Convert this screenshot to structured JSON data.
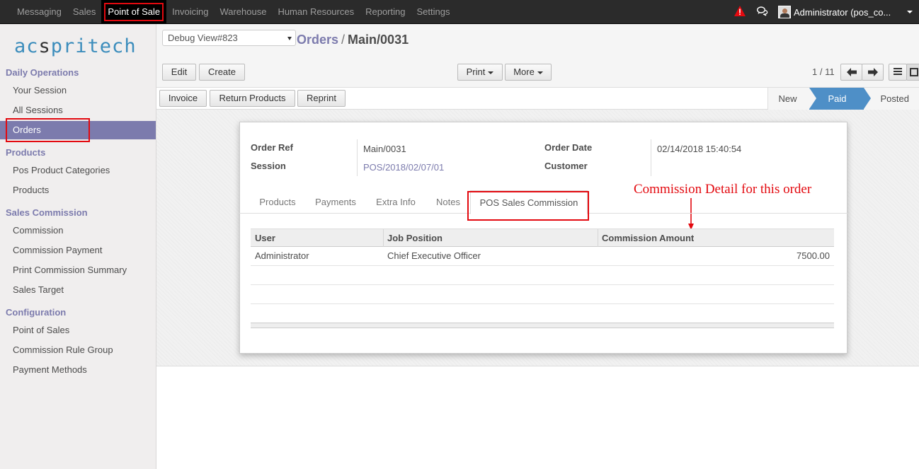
{
  "topnav": {
    "items": [
      "Messaging",
      "Sales",
      "Point of Sale",
      "Invoicing",
      "Warehouse",
      "Human Resources",
      "Reporting",
      "Settings"
    ],
    "active": "Point of Sale",
    "user": "Administrator (pos_co..."
  },
  "sidebar": {
    "logo_left": "ac",
    "logo_mid": "s",
    "logo_right": "pritech",
    "sections": [
      {
        "title": "Daily Operations",
        "items": [
          "Your Session",
          "All Sessions",
          "Orders"
        ]
      },
      {
        "title": "Products",
        "items": [
          "Pos Product Categories",
          "Products"
        ]
      },
      {
        "title": "Sales Commission",
        "items": [
          "Commission",
          "Commission Payment",
          "Print Commission Summary",
          "Sales Target"
        ]
      },
      {
        "title": "Configuration",
        "items": [
          "Point of Sales",
          "Commission Rule Group",
          "Payment Methods"
        ]
      }
    ],
    "active_item": "Orders"
  },
  "control": {
    "debug_view": "Debug View#823",
    "breadcrumb_parent": "Orders",
    "breadcrumb_sep": "/",
    "breadcrumb_current": "Main/0031",
    "edit_label": "Edit",
    "create_label": "Create",
    "print_label": "Print",
    "more_label": "More",
    "pager": "1 / 11"
  },
  "statusbar": {
    "buttons": [
      "Invoice",
      "Return Products",
      "Reprint"
    ],
    "stages": [
      "New",
      "Paid",
      "Posted"
    ],
    "current_stage": "Paid"
  },
  "form": {
    "order_ref_label": "Order Ref",
    "order_ref": "Main/0031",
    "session_label": "Session",
    "session": "POS/2018/02/07/01",
    "order_date_label": "Order Date",
    "order_date": "02/14/2018 15:40:54",
    "customer_label": "Customer",
    "customer": ""
  },
  "tabs": [
    "Products",
    "Payments",
    "Extra Info",
    "Notes",
    "POS Sales Commission"
  ],
  "active_tab": "POS Sales Commission",
  "annotation": "Commission Detail for this order",
  "commission_table": {
    "columns": [
      "User",
      "Job Position",
      "Commission Amount"
    ],
    "rows": [
      {
        "user": "Administrator",
        "job_position": "Chief Executive Officer",
        "amount": "7500.00"
      }
    ]
  },
  "colors": {
    "topbar": "#2b2b2b",
    "accent": "#7c7bad",
    "highlight": "#e3090f",
    "stage_active": "#4e8fc7"
  }
}
